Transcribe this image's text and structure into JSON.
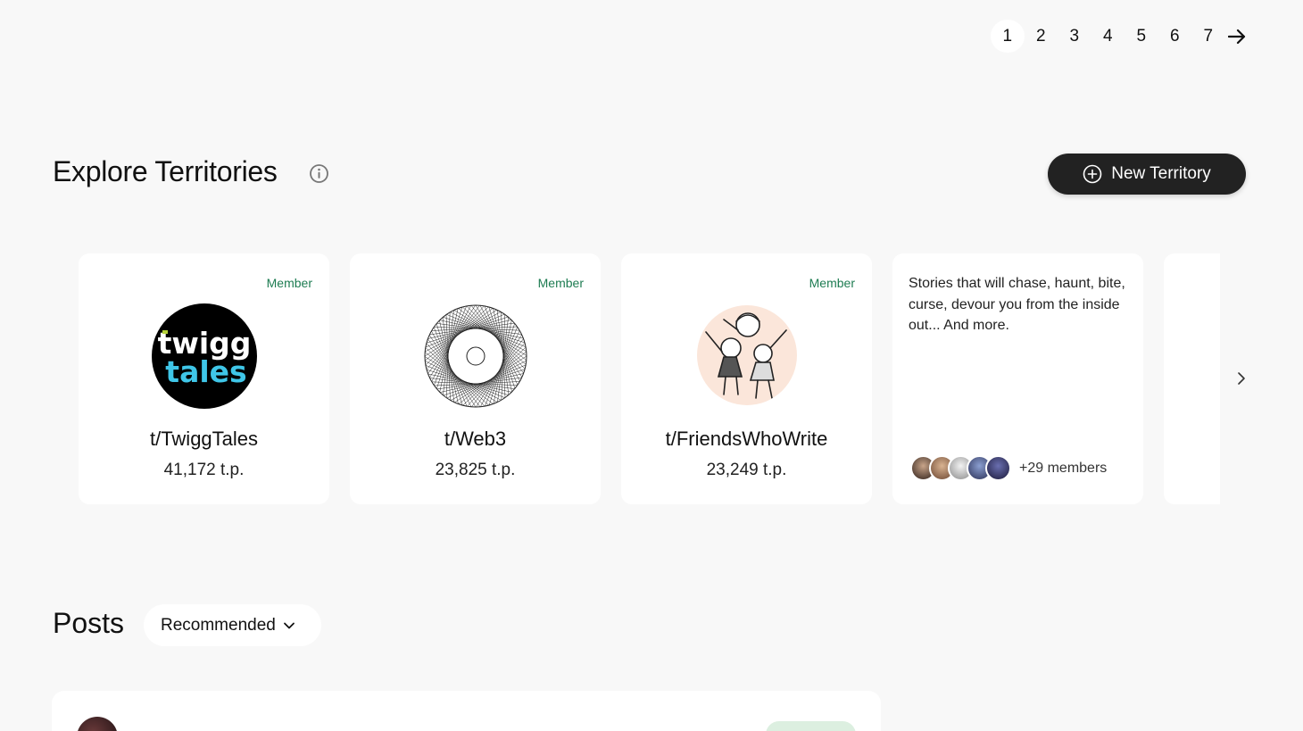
{
  "pagination": {
    "pages": [
      "1",
      "2",
      "3",
      "4",
      "5",
      "6",
      "7"
    ],
    "active": "1",
    "next_icon": "arrow-right-icon"
  },
  "explore": {
    "title": "Explore Territories",
    "info_icon": "info-icon",
    "new_button_label": "New Territory",
    "new_button_icon": "plus-circle-icon"
  },
  "territories": [
    {
      "badge": "Member",
      "name": "t/TwiggTales",
      "score": "41,172 t.p.",
      "logo_text": [
        "twigg",
        "tales"
      ]
    },
    {
      "badge": "Member",
      "name": "t/Web3",
      "score": "23,825 t.p."
    },
    {
      "badge": "Member",
      "name": "t/FriendsWhoWrite",
      "score": "23,249 t.p."
    },
    {
      "description": "Stories that will chase, haunt, bite, curse, devour you from the inside out... And more.",
      "member_count": "+29 members"
    }
  ],
  "carousel_next_icon": "chevron-right-icon",
  "posts": {
    "title": "Posts",
    "sort_label": "Recommended",
    "sort_icon": "chevron-down-icon"
  },
  "colors": {
    "background": "#f8f8f8",
    "card": "#ffffff",
    "member_green": "#1e7c52",
    "button_dark": "#222222",
    "twigg_yellow": "#b6d33a",
    "twigg_blue": "#3fc6e8"
  }
}
